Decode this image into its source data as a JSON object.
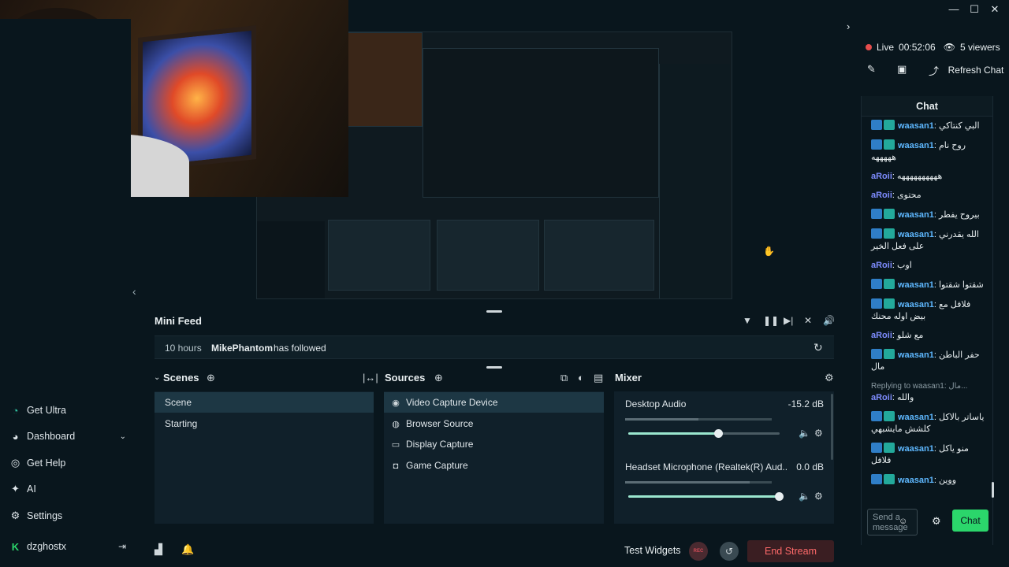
{
  "window": {
    "minimize": "—",
    "maximize": "☐",
    "close": "✕"
  },
  "sidebar": {
    "items": [
      {
        "label": "Get Ultra",
        "icon": "ultra-icon"
      },
      {
        "label": "Dashboard",
        "icon": "dashboard-icon"
      },
      {
        "label": "Get Help",
        "icon": "help-icon"
      },
      {
        "label": "AI",
        "icon": "sparkle-icon"
      },
      {
        "label": "Settings",
        "icon": "gear-icon"
      }
    ],
    "account": {
      "name": "dzghostx"
    }
  },
  "chat": {
    "live_label": "Live",
    "live_time": "00:52:06",
    "viewers": "5 viewers",
    "refresh_label": "Refresh Chat",
    "header": "Chat",
    "messages": [
      {
        "user": "waasan1",
        "type": "w",
        "text": "البي كنتاكي"
      },
      {
        "user": "waasan1",
        "type": "w",
        "text": "روح نام هههههه"
      },
      {
        "user": "aRoii",
        "type": "a",
        "text": "ههههههههههه"
      },
      {
        "user": "aRoii",
        "type": "a",
        "text": "محتوى"
      },
      {
        "user": "waasan1",
        "type": "w",
        "text": "بيروح يفطر"
      },
      {
        "user": "waasan1",
        "type": "w",
        "text": "الله يقدرني على فعل الخير"
      },
      {
        "user": "aRoii",
        "type": "a",
        "text": "اوب"
      },
      {
        "user": "waasan1",
        "type": "w",
        "text": "شقتوا شقتوا"
      },
      {
        "user": "waasan1",
        "type": "w",
        "text": "فلافل مع بيض اوله محنك"
      },
      {
        "user": "aRoii",
        "type": "a",
        "text": "مع شلو"
      },
      {
        "user": "waasan1",
        "type": "w",
        "text": "حفر الباطن مال"
      },
      {
        "user": "aRoii",
        "type": "a",
        "text": "والله",
        "reply": "Replying to waasan1: مال..."
      },
      {
        "user": "waasan1",
        "type": "w",
        "text": "ياساتر بالاكل كلشش مايشبهي"
      },
      {
        "user": "waasan1",
        "type": "w",
        "text": "منو ياكل فلافل"
      },
      {
        "user": "waasan1",
        "type": "w",
        "text": "ووين"
      }
    ],
    "send_placeholder": "Send a message",
    "send_button": "Chat"
  },
  "minifeed": {
    "title": "Mini Feed",
    "event": {
      "time": "10 hours",
      "user": "MikePhantom",
      "action": "has followed"
    }
  },
  "scenes": {
    "title": "Scenes",
    "items": [
      "Scene",
      "Starting"
    ],
    "selected": "Scene"
  },
  "sources": {
    "title": "Sources",
    "items": [
      {
        "label": "Video Capture Device",
        "icon": "camera-icon"
      },
      {
        "label": "Browser Source",
        "icon": "globe-icon"
      },
      {
        "label": "Display Capture",
        "icon": "monitor-icon"
      },
      {
        "label": "Game Capture",
        "icon": "gamepad-icon"
      }
    ]
  },
  "mixer": {
    "title": "Mixer",
    "channels": [
      {
        "name": "Desktop Audio",
        "db": "-15.2 dB",
        "volume": 0.6,
        "level": 0.5
      },
      {
        "name": "Headset Microphone (Realtek(R) Aud...",
        "db": "0.0 dB",
        "volume": 1.0,
        "level": 0.85
      }
    ]
  },
  "bottom": {
    "test_widgets": "Test Widgets",
    "rec": "REC",
    "end_stream": "End Stream"
  },
  "colors": {
    "background": "#09161d",
    "panel": "#10202a",
    "accent": "#2bd66b",
    "end_stream": "#ff6a6a",
    "live_dot": "#e64d4d"
  }
}
